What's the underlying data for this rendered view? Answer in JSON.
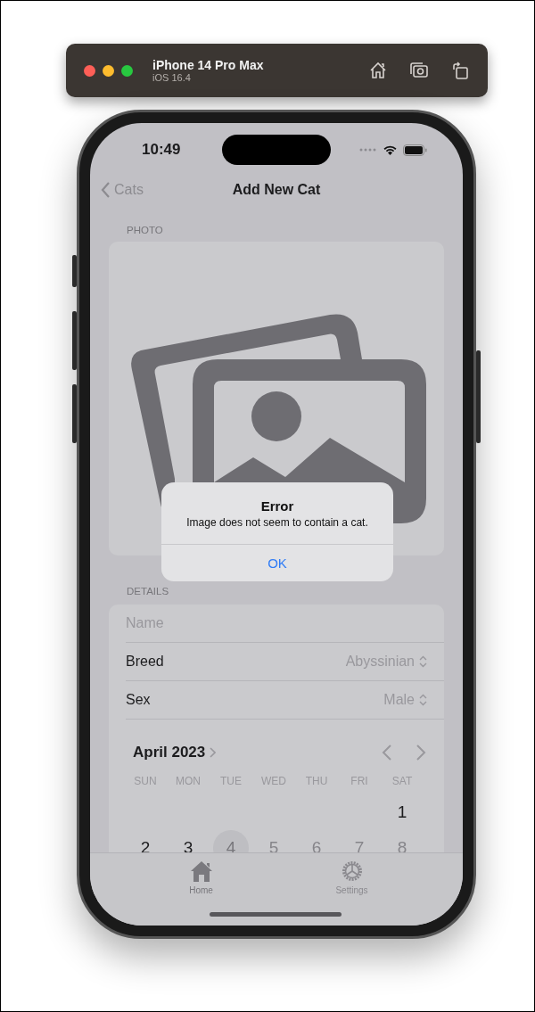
{
  "simulator": {
    "device": "iPhone 14 Pro Max",
    "os": "iOS 16.4"
  },
  "status_bar": {
    "time": "10:49"
  },
  "nav": {
    "back": "Cats",
    "title": "Add New Cat"
  },
  "photo_section": {
    "header": "PHOTO"
  },
  "alert": {
    "title": "Error",
    "message": "Image does not seem to contain a cat.",
    "button": "OK"
  },
  "details": {
    "header": "DETAILS",
    "name_placeholder": "Name",
    "rows": [
      {
        "label": "Breed",
        "value": "Abyssinian"
      },
      {
        "label": "Sex",
        "value": "Male"
      }
    ]
  },
  "calendar": {
    "month": "April 2023",
    "weekdays": [
      "SUN",
      "MON",
      "TUE",
      "WED",
      "THU",
      "FRI",
      "SAT"
    ],
    "weeks": [
      [
        {
          "kind": "blank"
        },
        {
          "kind": "blank"
        },
        {
          "kind": "blank"
        },
        {
          "kind": "blank"
        },
        {
          "kind": "blank"
        },
        {
          "kind": "blank"
        },
        {
          "kind": "day",
          "day": "1",
          "selected": false,
          "disabled": false
        }
      ],
      [
        {
          "kind": "day",
          "day": "2",
          "selected": false,
          "disabled": false
        },
        {
          "kind": "day",
          "day": "3",
          "selected": false,
          "disabled": false
        },
        {
          "kind": "day",
          "day": "4",
          "selected": true,
          "disabled": true
        },
        {
          "kind": "day",
          "day": "5",
          "selected": false,
          "disabled": true
        },
        {
          "kind": "day",
          "day": "6",
          "selected": false,
          "disabled": true
        },
        {
          "kind": "day",
          "day": "7",
          "selected": false,
          "disabled": true
        },
        {
          "kind": "day",
          "day": "8",
          "selected": false,
          "disabled": true
        }
      ]
    ]
  },
  "tab_bar": {
    "items": [
      {
        "kind": "home",
        "label": "Home",
        "selected": true
      },
      {
        "kind": "settings",
        "label": "Settings",
        "selected": false
      }
    ]
  }
}
